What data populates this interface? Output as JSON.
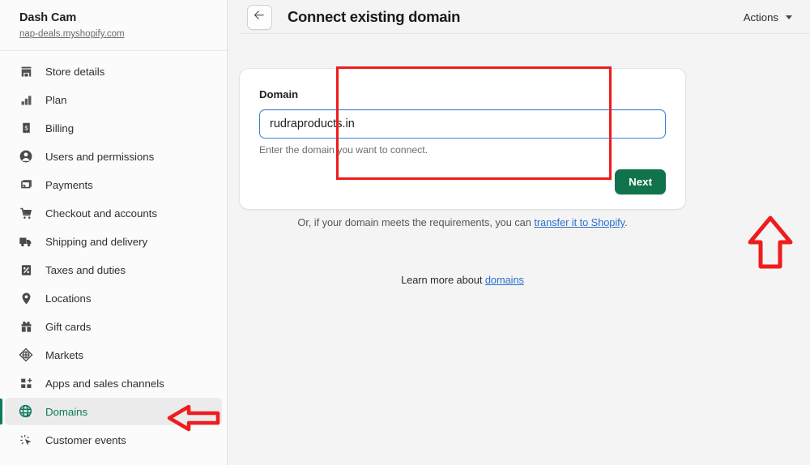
{
  "sidebar": {
    "store_name": "Dash Cam",
    "store_url": "nap-deals.myshopify.com",
    "items": [
      {
        "label": "Store details",
        "icon": "storefront-icon",
        "active": false
      },
      {
        "label": "Plan",
        "icon": "plan-icon",
        "active": false
      },
      {
        "label": "Billing",
        "icon": "billing-icon",
        "active": false
      },
      {
        "label": "Users and permissions",
        "icon": "user-icon",
        "active": false
      },
      {
        "label": "Payments",
        "icon": "payments-icon",
        "active": false
      },
      {
        "label": "Checkout and accounts",
        "icon": "cart-icon",
        "active": false
      },
      {
        "label": "Shipping and delivery",
        "icon": "truck-icon",
        "active": false
      },
      {
        "label": "Taxes and duties",
        "icon": "percent-icon",
        "active": false
      },
      {
        "label": "Locations",
        "icon": "location-pin-icon",
        "active": false
      },
      {
        "label": "Gift cards",
        "icon": "gift-icon",
        "active": false
      },
      {
        "label": "Markets",
        "icon": "markets-icon",
        "active": false
      },
      {
        "label": "Apps and sales channels",
        "icon": "apps-grid-icon",
        "active": false
      },
      {
        "label": "Domains",
        "icon": "globe-icon",
        "active": true
      },
      {
        "label": "Customer events",
        "icon": "cursor-click-icon",
        "active": false
      }
    ]
  },
  "topbar": {
    "back_icon": "back-arrow-icon",
    "title": "Connect existing domain",
    "actions_label": "Actions",
    "caret_icon": "chevron-down-icon"
  },
  "card": {
    "field_label": "Domain",
    "input_value": "rudraproducts.in",
    "input_placeholder": "",
    "helper_text": "Enter the domain you want to connect.",
    "next_label": "Next"
  },
  "footer": {
    "transfer_prefix": "Or, if your domain meets the requirements, you can ",
    "transfer_link": "transfer it to Shopify",
    "transfer_suffix": ".",
    "learn_prefix": "Learn more about ",
    "learn_link": "domains"
  },
  "colors": {
    "accent_green": "#0c7a5c",
    "button_green": "#11734b",
    "link_blue": "#2b6fce",
    "focus_blue": "#3b7fd4",
    "annotation_red": "#ee1c1c",
    "page_background": "#f4f4f4"
  }
}
